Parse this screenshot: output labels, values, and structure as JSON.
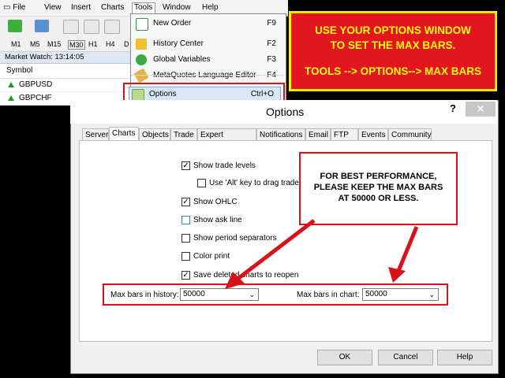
{
  "menubar": {
    "file": "File",
    "view": "View",
    "insert": "Insert",
    "charts": "Charts",
    "tools": "Tools",
    "window": "Window",
    "help": "Help"
  },
  "toolbar": {
    "timeframes": [
      "M1",
      "M5",
      "M15",
      "M30",
      "H1",
      "H4",
      "D"
    ]
  },
  "market_watch": {
    "title": "Market Watch: 13:14:05",
    "col_symbol": "Symbol",
    "symbols": [
      "GBPUSD",
      "GBPCHF"
    ]
  },
  "tools_menu": {
    "items": [
      {
        "label": "New Order",
        "shortcut": "F9",
        "icon": "new-order-icon"
      },
      {
        "label": "History Center",
        "shortcut": "F2",
        "icon": "history-center-icon"
      },
      {
        "label": "Global Variables",
        "shortcut": "F3",
        "icon": "global-variables-icon"
      },
      {
        "label": "MetaQuotes Language Editor",
        "shortcut": "F4",
        "icon": "editor-icon"
      },
      {
        "label": "Options",
        "shortcut": "Ctrl+O",
        "icon": "options-icon"
      }
    ]
  },
  "callout_top": {
    "line1": "USE YOUR OPTIONS WINDOW",
    "line2": "TO SET THE MAX BARS.",
    "line3": "TOOLS --> OPTIONS--> MAX BARS"
  },
  "dialog": {
    "title": "Options",
    "help_glyph": "?",
    "close_glyph": "✕",
    "tabs": [
      "Server",
      "Charts",
      "Objects",
      "Trade",
      "Expert Advisors",
      "Notifications",
      "Email",
      "FTP",
      "Events",
      "Community"
    ],
    "checkboxes": [
      {
        "label": "Show trade levels",
        "checked": true
      },
      {
        "label": "Use 'Alt' key to drag trade",
        "checked": false
      },
      {
        "label": "Show OHLC",
        "checked": true
      },
      {
        "label": "Show ask line",
        "checked": false
      },
      {
        "label": "Show period separators",
        "checked": false
      },
      {
        "label": "Color print",
        "checked": false
      },
      {
        "label": "Save deleted charts to reopen",
        "checked": true
      }
    ],
    "max_bars_history_label": "Max bars in history:",
    "max_bars_history_value": "50000",
    "max_bars_chart_label": "Max bars in chart:",
    "max_bars_chart_value": "50000",
    "ok": "OK",
    "cancel": "Cancel",
    "help": "Help"
  },
  "callout_mid": {
    "line1": "FOR BEST PERFORMANCE,",
    "line2": "PLEASE KEEP THE MAX BARS",
    "line3": "AT 50000 OR LESS."
  }
}
